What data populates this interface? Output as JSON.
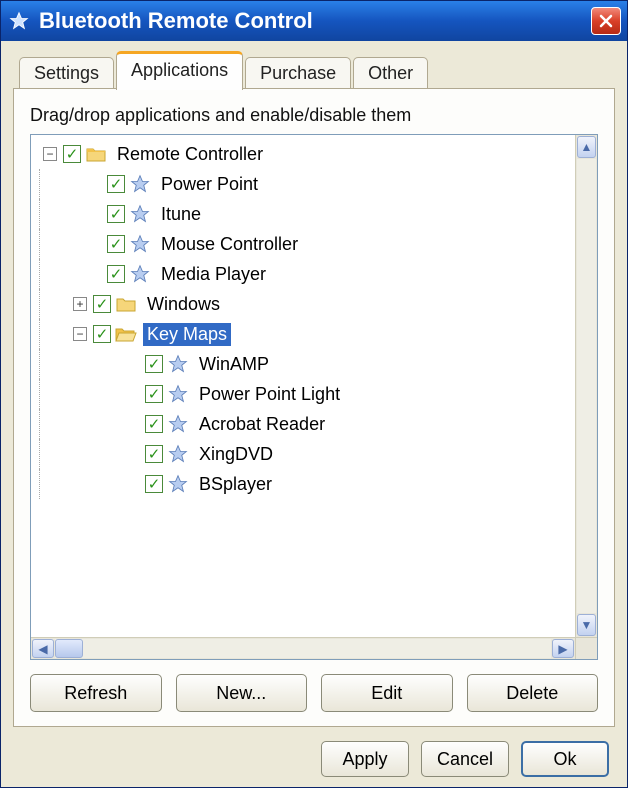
{
  "window": {
    "title": "Bluetooth Remote Control"
  },
  "tabs": {
    "settings": "Settings",
    "applications": "Applications",
    "purchase": "Purchase",
    "other": "Other"
  },
  "panel": {
    "instruction": "Drag/drop applications and enable/disable them"
  },
  "tree": {
    "root": {
      "label": "Remote Controller",
      "expanded": true,
      "checked": true,
      "icon": "folder",
      "children": [
        {
          "label": "Power Point",
          "checked": true,
          "icon": "star"
        },
        {
          "label": "Itune",
          "checked": true,
          "icon": "star"
        },
        {
          "label": "Mouse Controller",
          "checked": true,
          "icon": "star"
        },
        {
          "label": "Media Player",
          "checked": true,
          "icon": "star"
        },
        {
          "label": "Windows",
          "checked": true,
          "icon": "folder",
          "expanded": false,
          "hasChildren": true
        },
        {
          "label": "Key Maps",
          "checked": true,
          "icon": "folder",
          "expanded": true,
          "selected": true,
          "children": [
            {
              "label": "WinAMP",
              "checked": true,
              "icon": "star"
            },
            {
              "label": "Power Point Light",
              "checked": true,
              "icon": "star"
            },
            {
              "label": "Acrobat Reader",
              "checked": true,
              "icon": "star"
            },
            {
              "label": "XingDVD",
              "checked": true,
              "icon": "star"
            },
            {
              "label": "BSplayer",
              "checked": true,
              "icon": "star"
            }
          ]
        }
      ]
    }
  },
  "actions": {
    "refresh": "Refresh",
    "new": "New...",
    "edit": "Edit",
    "delete": "Delete"
  },
  "dialog": {
    "apply": "Apply",
    "cancel": "Cancel",
    "ok": "Ok"
  }
}
